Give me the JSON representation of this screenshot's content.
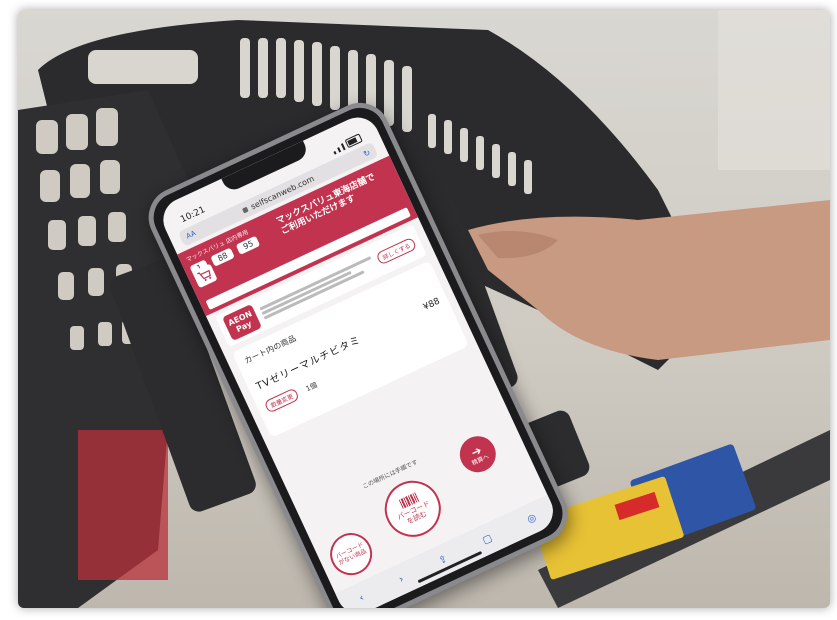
{
  "phone": {
    "status_time": "10:21",
    "url": "selfscanweb.com",
    "url_text_size": "AA",
    "promo": {
      "header_small": "マックスバリュ 店内専用",
      "points": [
        "1",
        "88",
        "95"
      ],
      "headline_line1": "マックスバリュ東海店舗で",
      "headline_line2": "ご利用いただけます"
    },
    "aeon_pay": {
      "logo_line1": "AEON",
      "logo_line2": "Pay",
      "detail_button": "詳しくする"
    },
    "cart": {
      "heading": "カート内の商品",
      "item_name": "TVゼリーマルチビタミ",
      "item_price": "¥88",
      "change_button": "数量変更",
      "quantity": "1個"
    },
    "hint_text": "この場所には手順です",
    "buttons": {
      "no_barcode_line1": "バーコード",
      "no_barcode_line2": "がない商品",
      "scan_line1": "バーコード",
      "scan_line2": "を読む",
      "checkout": "精算へ"
    }
  },
  "colors": {
    "accent": "#c2334f",
    "cart_body": "#2a2a2c",
    "safari_blue": "#2a62c9"
  }
}
